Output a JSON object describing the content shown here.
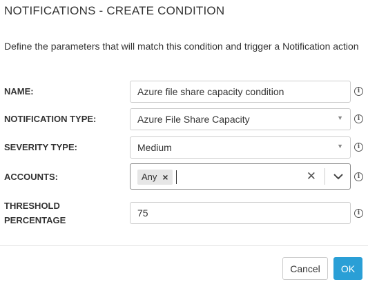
{
  "dialog": {
    "title": "NOTIFICATIONS - CREATE CONDITION",
    "description": "Define the parameters that will match this condition and trigger a Notification action"
  },
  "form": {
    "name": {
      "label": "NAME:",
      "value": "Azure file share capacity condition"
    },
    "notification_type": {
      "label": "NOTIFICATION TYPE:",
      "value": "Azure File Share Capacity"
    },
    "severity_type": {
      "label": "SEVERITY TYPE:",
      "value": "Medium"
    },
    "accounts": {
      "label": "ACCOUNTS:",
      "tags": [
        "Any"
      ]
    },
    "threshold": {
      "label_line1": "THRESHOLD",
      "label_line2": "PERCENTAGE",
      "value": "75"
    }
  },
  "icons": {
    "info": "info-circle-icon",
    "dropdown": "caret-down-icon",
    "clear": "clear-x-icon",
    "chevron": "chevron-down-icon",
    "tag_remove": "tag-remove-icon"
  },
  "footer": {
    "cancel_label": "Cancel",
    "ok_label": "OK"
  },
  "colors": {
    "primary": "#2a9fd6",
    "border": "#cccccc",
    "tag_bg": "#e6e6e6"
  }
}
